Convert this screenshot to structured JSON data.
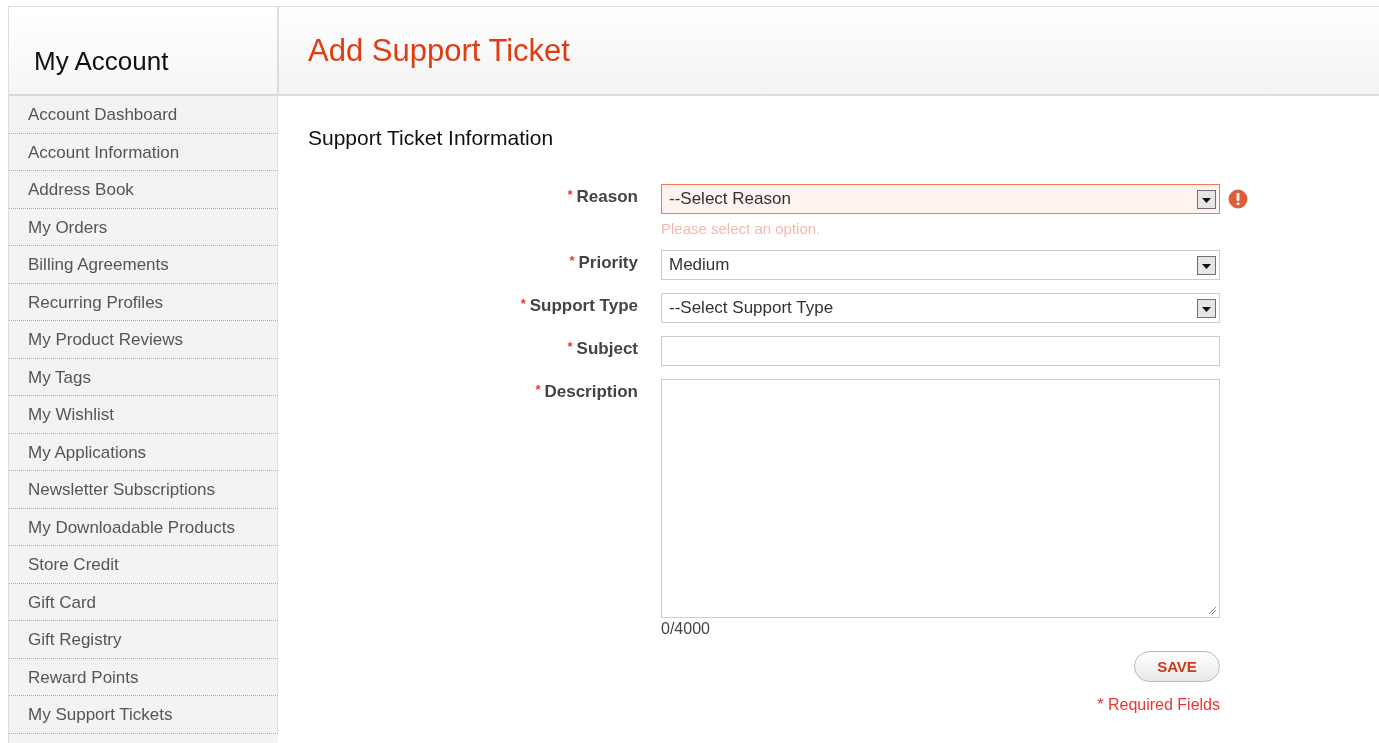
{
  "sidebar": {
    "title": "My Account",
    "items": [
      {
        "label": "Account Dashboard"
      },
      {
        "label": "Account Information"
      },
      {
        "label": "Address Book"
      },
      {
        "label": "My Orders"
      },
      {
        "label": "Billing Agreements"
      },
      {
        "label": "Recurring Profiles"
      },
      {
        "label": "My Product Reviews"
      },
      {
        "label": "My Tags"
      },
      {
        "label": "My Wishlist"
      },
      {
        "label": "My Applications"
      },
      {
        "label": "Newsletter Subscriptions"
      },
      {
        "label": "My Downloadable Products"
      },
      {
        "label": "Store Credit"
      },
      {
        "label": "Gift Card"
      },
      {
        "label": "Gift Registry"
      },
      {
        "label": "Reward Points"
      },
      {
        "label": "My Support Tickets"
      }
    ]
  },
  "page": {
    "title": "Add Support Ticket",
    "section": "Support Ticket Information",
    "fields": [
      {
        "kind": "select",
        "mark": "*",
        "label": "Reason",
        "value": "--Select Reason",
        "invalid": true,
        "error": "Please select an option."
      },
      {
        "kind": "select",
        "mark": "*",
        "label": "Priority",
        "value": "Medium",
        "invalid": false
      },
      {
        "kind": "select",
        "mark": "*",
        "label": "Support Type",
        "value": "--Select Support Type",
        "invalid": false
      },
      {
        "kind": "text",
        "mark": "*",
        "label": "Subject",
        "invalid": false
      },
      {
        "kind": "textarea",
        "mark": "*",
        "label": "Description",
        "invalid": false,
        "counter": "0/4000"
      }
    ],
    "save": "SAVE",
    "required_note": "* Required Fields"
  }
}
